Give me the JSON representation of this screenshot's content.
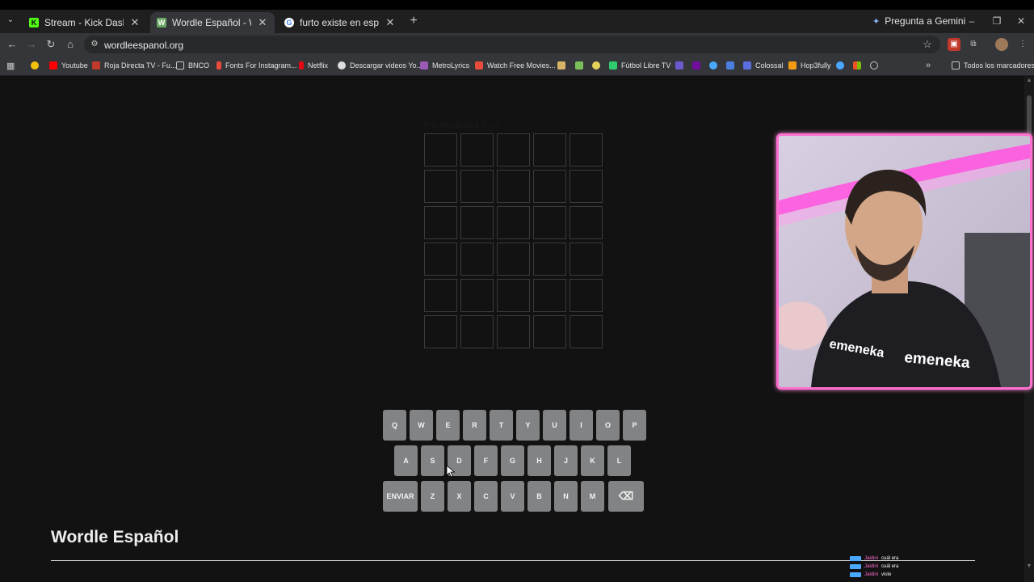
{
  "browser": {
    "tabs": [
      {
        "label": "Stream - Kick Dashboard",
        "favicon": "kick-icon",
        "active": false
      },
      {
        "label": "Wordle Español - Wordle ilimita",
        "favicon": "wordle-icon",
        "active": true
      },
      {
        "label": "furto existe en español - Busca",
        "favicon": "google-icon",
        "active": false
      }
    ],
    "gemini_label": "Pregunta a Gemini",
    "url": "wordleespanol.org",
    "bookmarks": [
      {
        "label": "",
        "color": "#f4c20d"
      },
      {
        "label": "Youtube",
        "color": "#ff0000"
      },
      {
        "label": "Roja Directa TV - Fu...",
        "color": "#c0392b"
      },
      {
        "label": "BNCO",
        "color": "#c4c7c5"
      },
      {
        "label": "Fonts For Instagram...",
        "color": "#e74c3c"
      },
      {
        "label": "Netflix",
        "color": "#e50914"
      },
      {
        "label": "Descargar videos Yo...",
        "color": "#dddddd"
      },
      {
        "label": "MetroLyrics",
        "color": "#9b59b6"
      },
      {
        "label": "Watch Free Movies...",
        "color": "#e74c3c"
      },
      {
        "label": "Fútbol Libre TV",
        "color": "#2ecc71"
      },
      {
        "label": "Colossal",
        "color": "#5b6ee1"
      },
      {
        "label": "Hop3fully",
        "color": "#f39c12"
      },
      {
        "label": "Todos los marcadores",
        "color": "#c4c7c5"
      }
    ]
  },
  "game": {
    "hint": "Por simplicidad Ñ→n",
    "rows": 6,
    "cols": 5,
    "keyboard": {
      "row1": [
        "Q",
        "W",
        "E",
        "R",
        "T",
        "Y",
        "U",
        "I",
        "O",
        "P"
      ],
      "row2": [
        "A",
        "S",
        "D",
        "F",
        "G",
        "H",
        "J",
        "K",
        "L"
      ],
      "row3": [
        "ENVIAR",
        "Z",
        "X",
        "C",
        "V",
        "B",
        "N",
        "M"
      ],
      "backspace_icon": "⌫"
    },
    "title": "Wordle Español"
  },
  "chat": [
    {
      "user": "Jaidini",
      "msg": "cuál era"
    },
    {
      "user": "Jaidini",
      "msg": "cuál era"
    },
    {
      "user": "Jaidini",
      "msg": "viste"
    }
  ],
  "colors": {
    "key": "#818384",
    "tile_border": "#3a3a3c",
    "webcam_border": "#ff6fd0"
  }
}
